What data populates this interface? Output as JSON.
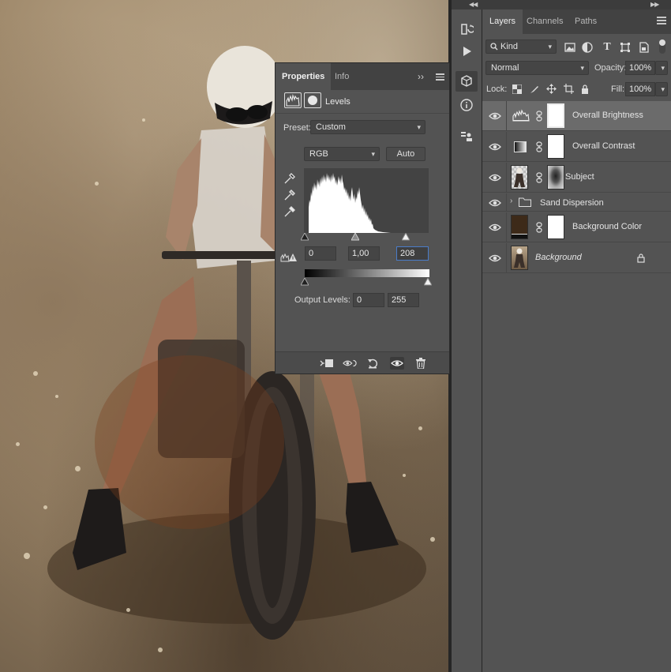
{
  "properties_panel": {
    "tabs": [
      "Properties",
      "Info"
    ],
    "adjustment_title": "Levels",
    "preset_label": "Preset:",
    "preset_value": "Custom",
    "channel_value": "RGB",
    "auto_label": "Auto",
    "input_black": "0",
    "input_gamma": "1,00",
    "input_white": "208",
    "output_label": "Output Levels:",
    "output_black": "0",
    "output_white": "255",
    "expand_glyph": "››"
  },
  "layers_panel": {
    "tabs": [
      "Layers",
      "Channels",
      "Paths"
    ],
    "filter_kind": "Kind",
    "blend_mode": "Normal",
    "opacity_label": "Opacity:",
    "opacity_value": "100%",
    "lock_label": "Lock:",
    "fill_label": "Fill:",
    "fill_value": "100%",
    "layers": [
      {
        "name": "Overall Brightness",
        "type": "levels",
        "selected": true
      },
      {
        "name": "Overall Contrast",
        "type": "gradient-map",
        "selected": false
      },
      {
        "name": "Subject",
        "type": "image-with-mask",
        "selected": false
      },
      {
        "name": "Sand Dispersion",
        "type": "group",
        "selected": false
      },
      {
        "name": "Background Color",
        "type": "solid-fill",
        "selected": false
      },
      {
        "name": "Background",
        "type": "background",
        "selected": false,
        "locked": true
      }
    ]
  },
  "colors": {
    "panel_bg": "#535353",
    "tab_bg": "#424242",
    "selected_layer": "#6b6b6b",
    "focus_blue": "#4a7cc9",
    "background_color_swatch": "#3d2a19"
  }
}
